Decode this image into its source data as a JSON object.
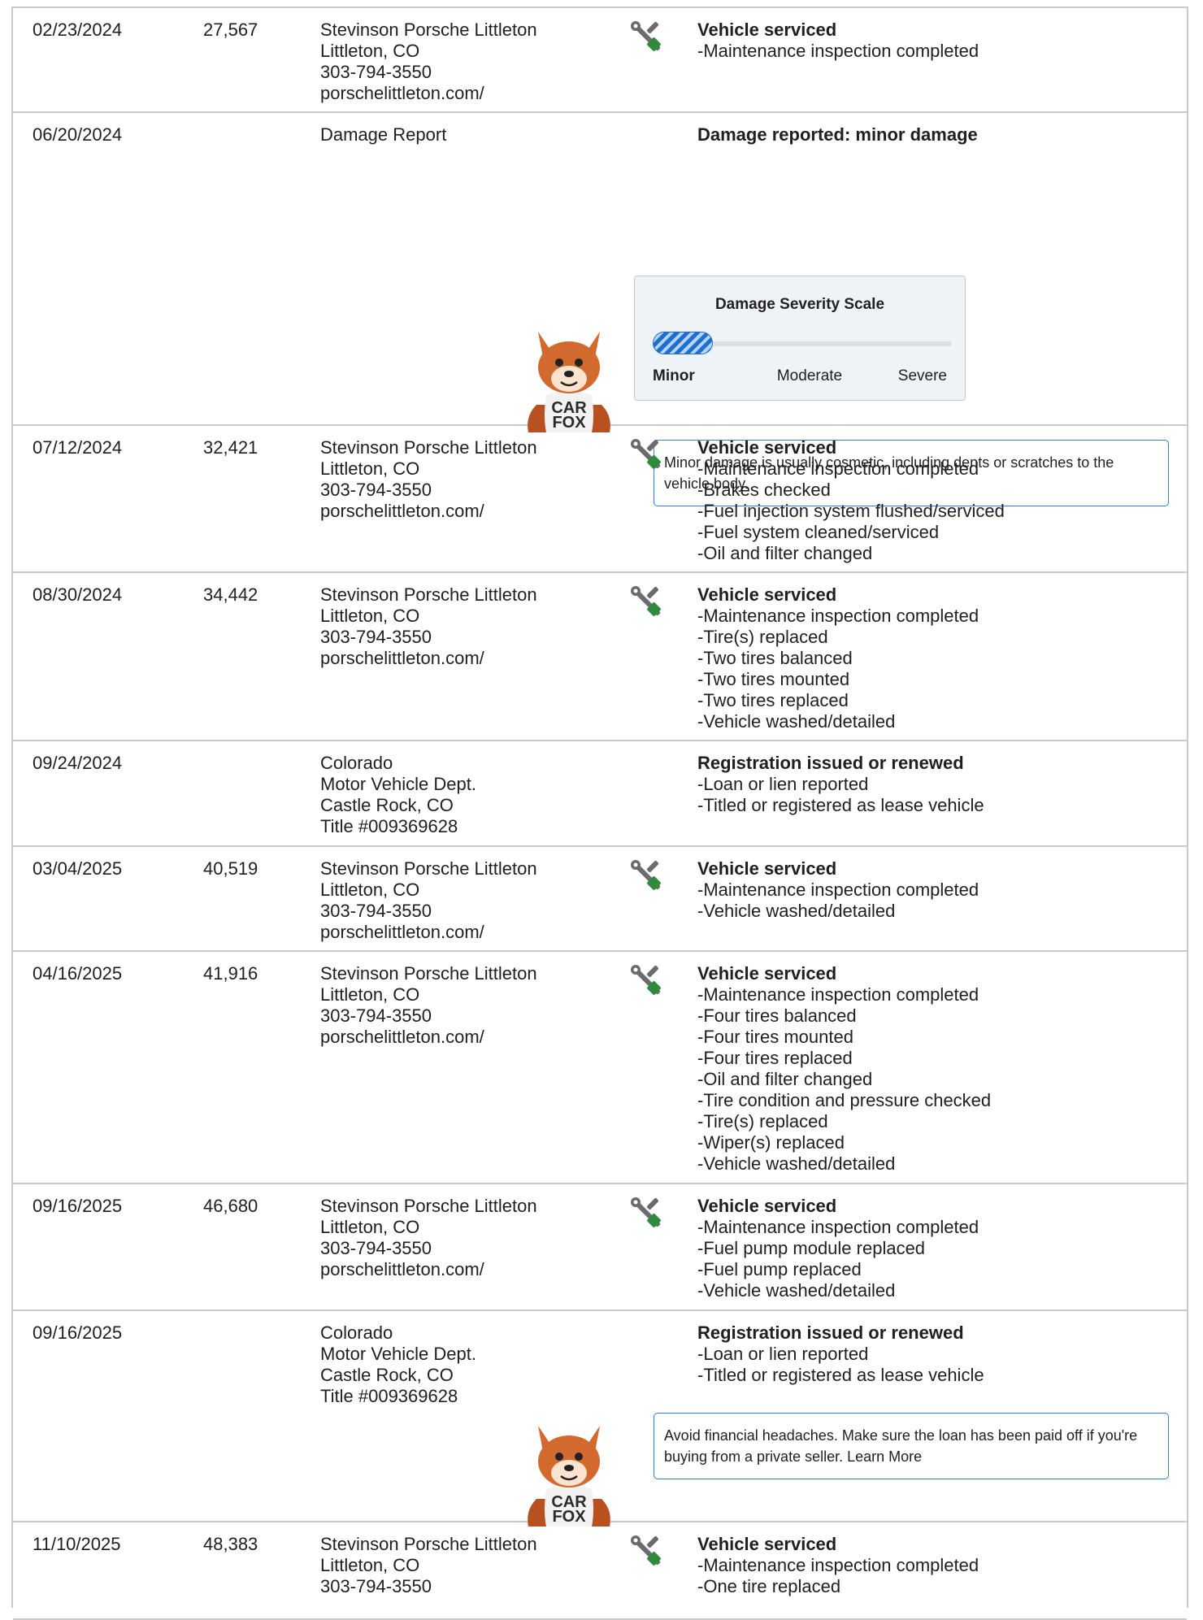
{
  "records": [
    {
      "date": "02/23/2024",
      "odometer": "27,567",
      "source": [
        "Stevinson Porsche Littleton",
        "Littleton, CO",
        "303-794-3550",
        "porschelittleton.com/"
      ],
      "icon": "service-tools-icon",
      "title": "Vehicle serviced",
      "items": [
        "Maintenance inspection completed"
      ]
    },
    {
      "date": "06/20/2024",
      "odometer": "",
      "source": [
        "Damage Report"
      ],
      "icon": "",
      "title": "Damage reported: minor damage",
      "items": []
    },
    {
      "date": "07/12/2024",
      "odometer": "32,421",
      "source": [
        "Stevinson Porsche Littleton",
        "Littleton, CO",
        "303-794-3550",
        "porschelittleton.com/"
      ],
      "icon": "service-tools-icon",
      "title": "Vehicle serviced",
      "items": [
        "Maintenance inspection completed",
        "Brakes checked",
        "Fuel injection system flushed/serviced",
        "Fuel system cleaned/serviced",
        "Oil and filter changed"
      ]
    },
    {
      "date": "08/30/2024",
      "odometer": "34,442",
      "source": [
        "Stevinson Porsche Littleton",
        "Littleton, CO",
        "303-794-3550",
        "porschelittleton.com/"
      ],
      "icon": "service-tools-icon",
      "title": "Vehicle serviced",
      "items": [
        "Maintenance inspection completed",
        "Tire(s) replaced",
        "Two tires balanced",
        "Two tires mounted",
        "Two tires replaced",
        "Vehicle washed/detailed"
      ]
    },
    {
      "date": "09/24/2024",
      "odometer": "",
      "source": [
        "Colorado",
        "Motor Vehicle Dept.",
        "Castle Rock, CO",
        "Title #009369628"
      ],
      "icon": "",
      "title": "Registration issued or renewed",
      "items": [
        "Loan or lien reported",
        "Titled or registered as lease vehicle"
      ]
    },
    {
      "date": "03/04/2025",
      "odometer": "40,519",
      "source": [
        "Stevinson Porsche Littleton",
        "Littleton, CO",
        "303-794-3550",
        "porschelittleton.com/"
      ],
      "icon": "service-tools-icon",
      "title": "Vehicle serviced",
      "items": [
        "Maintenance inspection completed",
        "Vehicle washed/detailed"
      ]
    },
    {
      "date": "04/16/2025",
      "odometer": "41,916",
      "source": [
        "Stevinson Porsche Littleton",
        "Littleton, CO",
        "303-794-3550",
        "porschelittleton.com/"
      ],
      "icon": "service-tools-icon",
      "title": "Vehicle serviced",
      "items": [
        "Maintenance inspection completed",
        "Four tires balanced",
        "Four tires mounted",
        "Four tires replaced",
        "Oil and filter changed",
        "Tire condition and pressure checked",
        "Tire(s) replaced",
        "Wiper(s) replaced",
        "Vehicle washed/detailed"
      ]
    },
    {
      "date": "09/16/2025",
      "odometer": "46,680",
      "source": [
        "Stevinson Porsche Littleton",
        "Littleton, CO",
        "303-794-3550",
        "porschelittleton.com/"
      ],
      "icon": "service-tools-icon",
      "title": "Vehicle serviced",
      "items": [
        "Maintenance inspection completed",
        "Fuel pump module replaced",
        "Fuel pump replaced",
        "Vehicle washed/detailed"
      ]
    },
    {
      "date": "09/16/2025",
      "odometer": "",
      "source": [
        "Colorado",
        "Motor Vehicle Dept.",
        "Castle Rock, CO",
        "Title #009369628"
      ],
      "icon": "",
      "title": "Registration issued or renewed",
      "items": [
        "Loan or lien reported",
        "Titled or registered as lease vehicle"
      ]
    },
    {
      "date": "11/10/2025",
      "odometer": "48,383",
      "source": [
        "Stevinson Porsche Littleton",
        "Littleton, CO",
        "303-794-3550"
      ],
      "icon": "service-tools-icon",
      "title": "Vehicle serviced",
      "items": [
        "Maintenance inspection completed",
        "One tire replaced"
      ]
    }
  ],
  "damage_scale": {
    "title": "Damage Severity Scale",
    "labels": [
      "Minor",
      "Moderate",
      "Severe"
    ],
    "selected": "Minor",
    "level_fraction": 0.2
  },
  "tips": [
    {
      "text": "Minor damage is usually cosmetic, including dents or scratches to the vehicle body."
    },
    {
      "text": "Avoid financial headaches. Make sure the loan has been paid off if you're buying from a private seller. Learn More"
    }
  ],
  "mascot": {
    "line1": "CAR",
    "line2": "FOX"
  },
  "colors": {
    "tip_border": "#2f7fd0",
    "scale_fill": "#1f6fd1",
    "icon_gray": "#6b6b6b",
    "icon_green": "#2e8b3c",
    "row_border": "#c9c9c9"
  }
}
